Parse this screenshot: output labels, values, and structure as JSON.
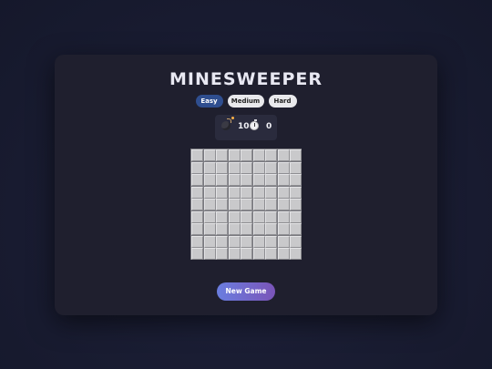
{
  "game": {
    "title": "MINESWEEPER",
    "difficulty": {
      "options": [
        "Easy",
        "Medium",
        "Hard"
      ],
      "selected": "Easy"
    },
    "status": {
      "mines_remaining": "10",
      "timer": "0"
    },
    "board": {
      "rows": 9,
      "cols": 9,
      "state": "all-covered"
    },
    "new_game_label": "New Game"
  },
  "colors": {
    "accent_selected": "#2f4e8f",
    "new_game_gradient_start": "#6a7ee0",
    "new_game_gradient_end": "#7a54b8",
    "card_bg": "#1f1f2e",
    "cell_bg": "#c9c9cb"
  },
  "icons": {
    "mines": "bomb-icon",
    "timer": "stopwatch-icon"
  }
}
